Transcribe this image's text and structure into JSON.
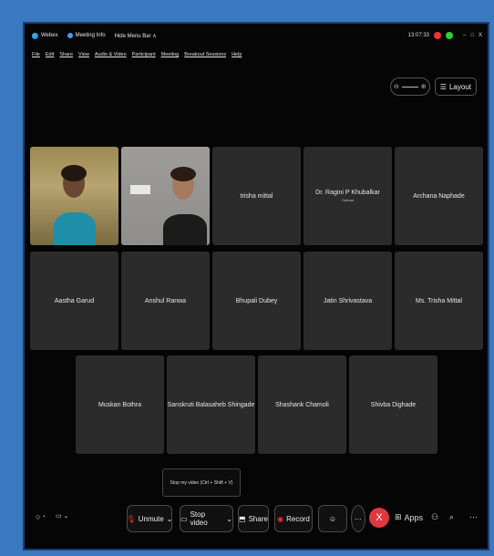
{
  "titlebar": {
    "app_name": "Webex",
    "meeting_info": "Meeting Info",
    "hide_menu": "Hide Menu Bar ∧",
    "time": "13:07:33",
    "minimize": "–",
    "maximize": "□",
    "close": "X"
  },
  "menu": [
    "File",
    "Edit",
    "Share",
    "View",
    "Audio & Video",
    "Participant",
    "Meeting",
    "Breakout Sessions",
    "Help"
  ],
  "topctrl": {
    "zoom_minus": "⊖",
    "zoom_plus": "⊕",
    "layout_label": "Layout",
    "layout_icon": "☰"
  },
  "participants": [
    {
      "name": "",
      "subtitle": ""
    },
    {
      "name": "",
      "subtitle": ""
    },
    {
      "name": "trisha mittal",
      "subtitle": ""
    },
    {
      "name": "Dr. Ragini P Khubalkar",
      "subtitle": "Cohost"
    },
    {
      "name": "Archana Naphade",
      "subtitle": ""
    },
    {
      "name": "Aastha Garud",
      "subtitle": ""
    },
    {
      "name": "Anshul Ranwa",
      "subtitle": ""
    },
    {
      "name": "Bhupali Dubey",
      "subtitle": ""
    },
    {
      "name": "Jatin Shrivastava",
      "subtitle": ""
    },
    {
      "name": "Ms. Trisha Mittal",
      "subtitle": ""
    },
    {
      "name": "Muskan Bothra",
      "subtitle": ""
    },
    {
      "name": "Sanskruti Balasaheb Shingade",
      "subtitle": ""
    },
    {
      "name": "Shashank Chamoli",
      "subtitle": ""
    },
    {
      "name": "Shivba Dighade",
      "subtitle": ""
    }
  ],
  "tooltip": "Stop my video (Ctrl + Shift + V)",
  "bottom": {
    "unmute": "Unmute",
    "stop_video": "Stop video",
    "share": "Share",
    "record": "Record",
    "apps": "Apps",
    "end": "X",
    "more": "···"
  },
  "colors": {
    "end_call": "#e0383e",
    "record": "#e33333",
    "accent": "#2a7de1"
  }
}
